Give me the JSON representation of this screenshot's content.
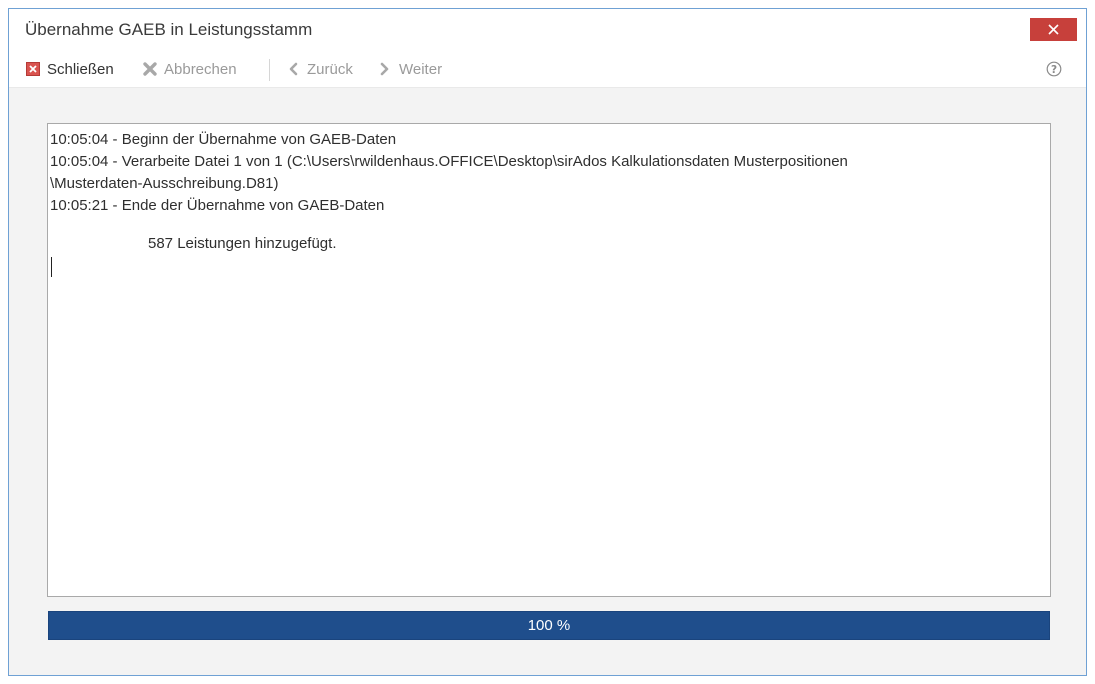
{
  "window": {
    "title": "Übernahme GAEB in Leistungsstamm"
  },
  "toolbar": {
    "close_label": "Schließen",
    "cancel_label": "Abbrechen",
    "back_label": "Zurück",
    "next_label": "Weiter"
  },
  "icons": {
    "close_window": "close-icon",
    "close_action": "close-box-icon",
    "cancel": "cancel-icon",
    "back": "chevron-left-icon",
    "next": "chevron-right-icon",
    "help": "help-icon"
  },
  "log": {
    "lines": [
      "10:05:04 - Beginn der Übernahme von GAEB-Daten",
      "10:05:04 - Verarbeite Datei 1 von 1 (C:\\Users\\rwildenhaus.OFFICE\\Desktop\\sirAdos Kalkulationsdaten Musterpositionen",
      "\\Musterdaten-Ausschreibung.D81)",
      "10:05:21 - Ende der Übernahme von GAEB-Daten"
    ],
    "summary": "587 Leistungen hinzugefügt."
  },
  "progress": {
    "percent": 100,
    "label": "100 %"
  },
  "colors": {
    "close_button": "#c7403b",
    "progress_bar": "#1f4e8c",
    "window_border": "#6fa1d4",
    "close_action_icon": "#d9534f"
  }
}
